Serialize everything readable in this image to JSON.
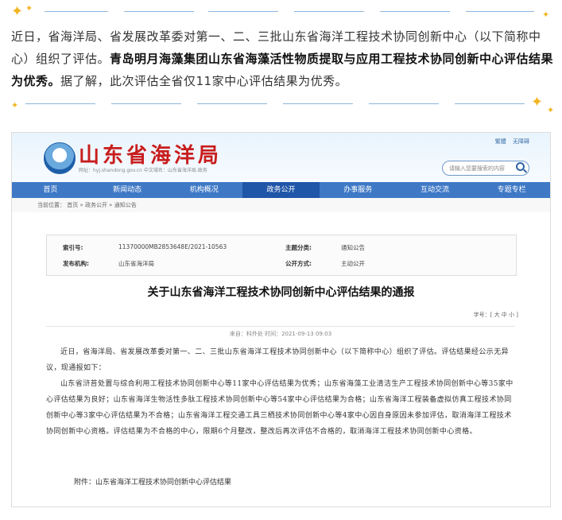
{
  "intro": {
    "part1": "近日，省海洋局、省发展改革委对第一、二、三批山东省海洋工程技术协同创新中心（以下简称中心）组织了评估。",
    "bold": "青岛明月海藻集团山东省海藻活性物质提取与应用工程技术协同创新中心评估结果为优秀。",
    "part2": "据了解，此次评估全省仅11家中心评估结果为优秀。"
  },
  "site": {
    "title": "山东省海洋局",
    "subtitle": "网址：hyj.shandong.gov.cn     中文域名：山东省海洋局.政务",
    "top_links": [
      "繁體",
      "无障碍"
    ],
    "search_placeholder": "请输入您要搜索的内容",
    "nav": [
      "首页",
      "新闻动态",
      "机构概况",
      "政务公开",
      "办事服务",
      "互动交流",
      "专题专栏"
    ],
    "active_nav": "政务公开",
    "breadcrumb": "当前位置： 首页 » 政务公开 » 通知公告"
  },
  "info": {
    "index_label": "索引号:",
    "index_value": "11370000MB2853648E/2021-10563",
    "topic_label": "主题分类:",
    "topic_value": "通知公告",
    "org_label": "发布机构:",
    "org_value": "山东省海洋局",
    "mode_label": "公开方式:",
    "mode_value": "主动公开"
  },
  "doc": {
    "title": "关于山东省海洋工程技术协同创新中心评估结果的通报",
    "font_size": "字号：[ 大 中 小 ]",
    "meta": "来自：科外处  时间：2021-09-13 09:03",
    "para1": "近日，省海洋局、省发展改革委对第一、二、三批山东省海洋工程技术协同创新中心（以下简称中心）组织了评估。评估结果经公示无异议，现通报如下：",
    "para2": "山东省浒苔处置与综合利用工程技术协同创新中心等11家中心评估结果为优秀；山东省海藻工业清洁生产工程技术协同创新中心等35家中心评估结果为良好；山东省海洋生物活性多肽工程技术协同创新中心等54家中心评估结果为合格；山东省海洋工程装备虚拟仿真工程技术协同创新中心等3家中心评估结果为不合格；山东省海洋工程交通工具三栖技术协同创新中心等4家中心因自身原因未参加评估，取消海洋工程技术协同创新中心资格。评估结果为不合格的中心，限期6个月整改，整改后再次评估不合格的，取消海洋工程技术协同创新中心资格。",
    "attachment": "附件：山东省海洋工程技术协同创新中心评估结果"
  },
  "colors": {
    "accent": "#3f79c6",
    "nav_active": "#1f56a8",
    "logo_red": "#c81d1d",
    "sparkle": "#f1b521"
  }
}
